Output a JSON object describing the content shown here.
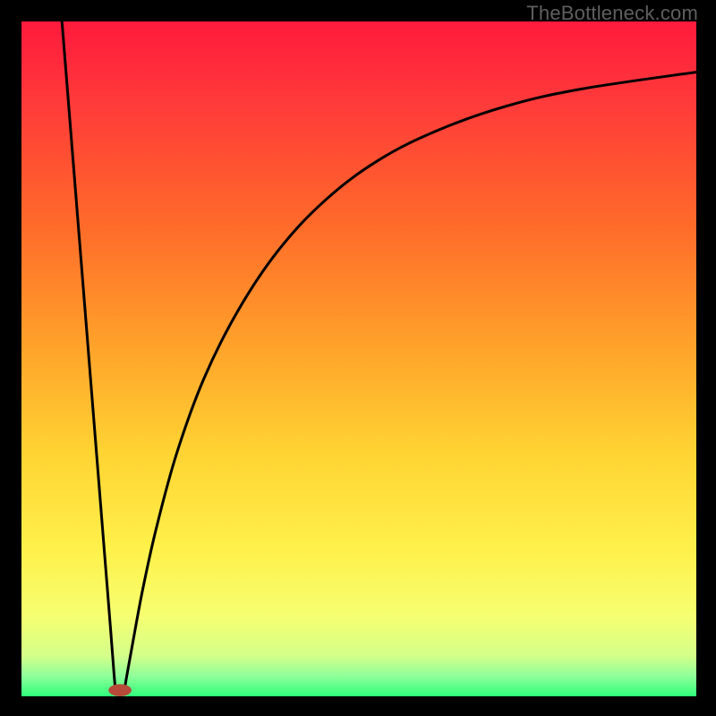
{
  "watermark": "TheBottleneck.com",
  "chart_data": {
    "type": "line",
    "title": "",
    "xlabel": "",
    "ylabel": "",
    "xlim": [
      0,
      100
    ],
    "ylim": [
      0,
      100
    ],
    "gradient_stops": [
      {
        "pct": 0,
        "color": "#ff1a3c"
      },
      {
        "pct": 12,
        "color": "#ff3a3a"
      },
      {
        "pct": 30,
        "color": "#ff6a2a"
      },
      {
        "pct": 48,
        "color": "#ffa22a"
      },
      {
        "pct": 64,
        "color": "#ffd433"
      },
      {
        "pct": 78,
        "color": "#fff04a"
      },
      {
        "pct": 88,
        "color": "#f6ff70"
      },
      {
        "pct": 94,
        "color": "#d4ff8a"
      },
      {
        "pct": 97,
        "color": "#8fff9a"
      },
      {
        "pct": 100,
        "color": "#2fff7a"
      }
    ],
    "series": [
      {
        "name": "left_branch",
        "type": "line",
        "points": [
          {
            "x": 6.0,
            "y": 100.0
          },
          {
            "x": 6.8,
            "y": 90.0
          },
          {
            "x": 7.6,
            "y": 80.0
          },
          {
            "x": 8.4,
            "y": 70.0
          },
          {
            "x": 9.2,
            "y": 60.0
          },
          {
            "x": 10.0,
            "y": 50.0
          },
          {
            "x": 10.8,
            "y": 40.0
          },
          {
            "x": 11.6,
            "y": 30.0
          },
          {
            "x": 12.4,
            "y": 20.0
          },
          {
            "x": 13.2,
            "y": 10.0
          },
          {
            "x": 13.7,
            "y": 3.5
          },
          {
            "x": 13.9,
            "y": 1.2
          }
        ]
      },
      {
        "name": "right_branch",
        "type": "line",
        "points": [
          {
            "x": 15.3,
            "y": 1.2
          },
          {
            "x": 15.6,
            "y": 3.0
          },
          {
            "x": 16.5,
            "y": 8.0
          },
          {
            "x": 18.0,
            "y": 16.0
          },
          {
            "x": 20.0,
            "y": 25.0
          },
          {
            "x": 23.0,
            "y": 36.0
          },
          {
            "x": 27.0,
            "y": 47.0
          },
          {
            "x": 32.0,
            "y": 57.0
          },
          {
            "x": 38.0,
            "y": 66.0
          },
          {
            "x": 45.0,
            "y": 73.5
          },
          {
            "x": 53.0,
            "y": 79.5
          },
          {
            "x": 62.0,
            "y": 84.0
          },
          {
            "x": 72.0,
            "y": 87.5
          },
          {
            "x": 83.0,
            "y": 90.0
          },
          {
            "x": 100.0,
            "y": 92.5
          }
        ]
      }
    ],
    "marker": {
      "name": "min_marker",
      "cx": 14.6,
      "cy": 0.9,
      "rx": 1.7,
      "ry": 0.9,
      "color": "#b84a3a"
    }
  }
}
